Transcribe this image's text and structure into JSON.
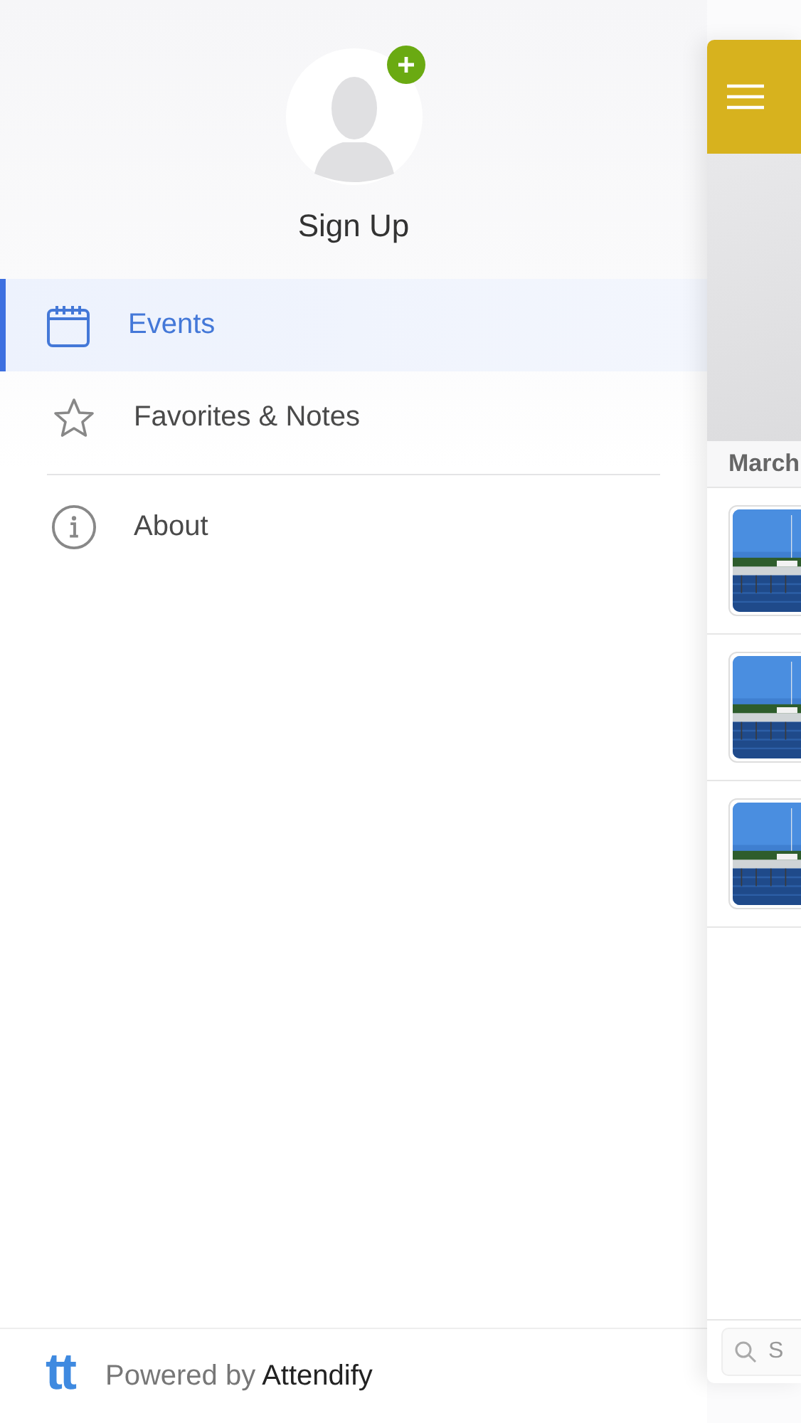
{
  "profile": {
    "name": "Sign Up"
  },
  "menu": [
    {
      "label": "Events",
      "selected": true
    },
    {
      "label": "Favorites & Notes",
      "selected": false
    }
  ],
  "secondary_menu": [
    {
      "label": "About",
      "selected": false
    }
  ],
  "footer": {
    "logo": "tt",
    "prefix": "Powered by",
    "brand": "Attendify"
  },
  "main_panel": {
    "section": "March",
    "search": {
      "placeholder": "S"
    }
  }
}
